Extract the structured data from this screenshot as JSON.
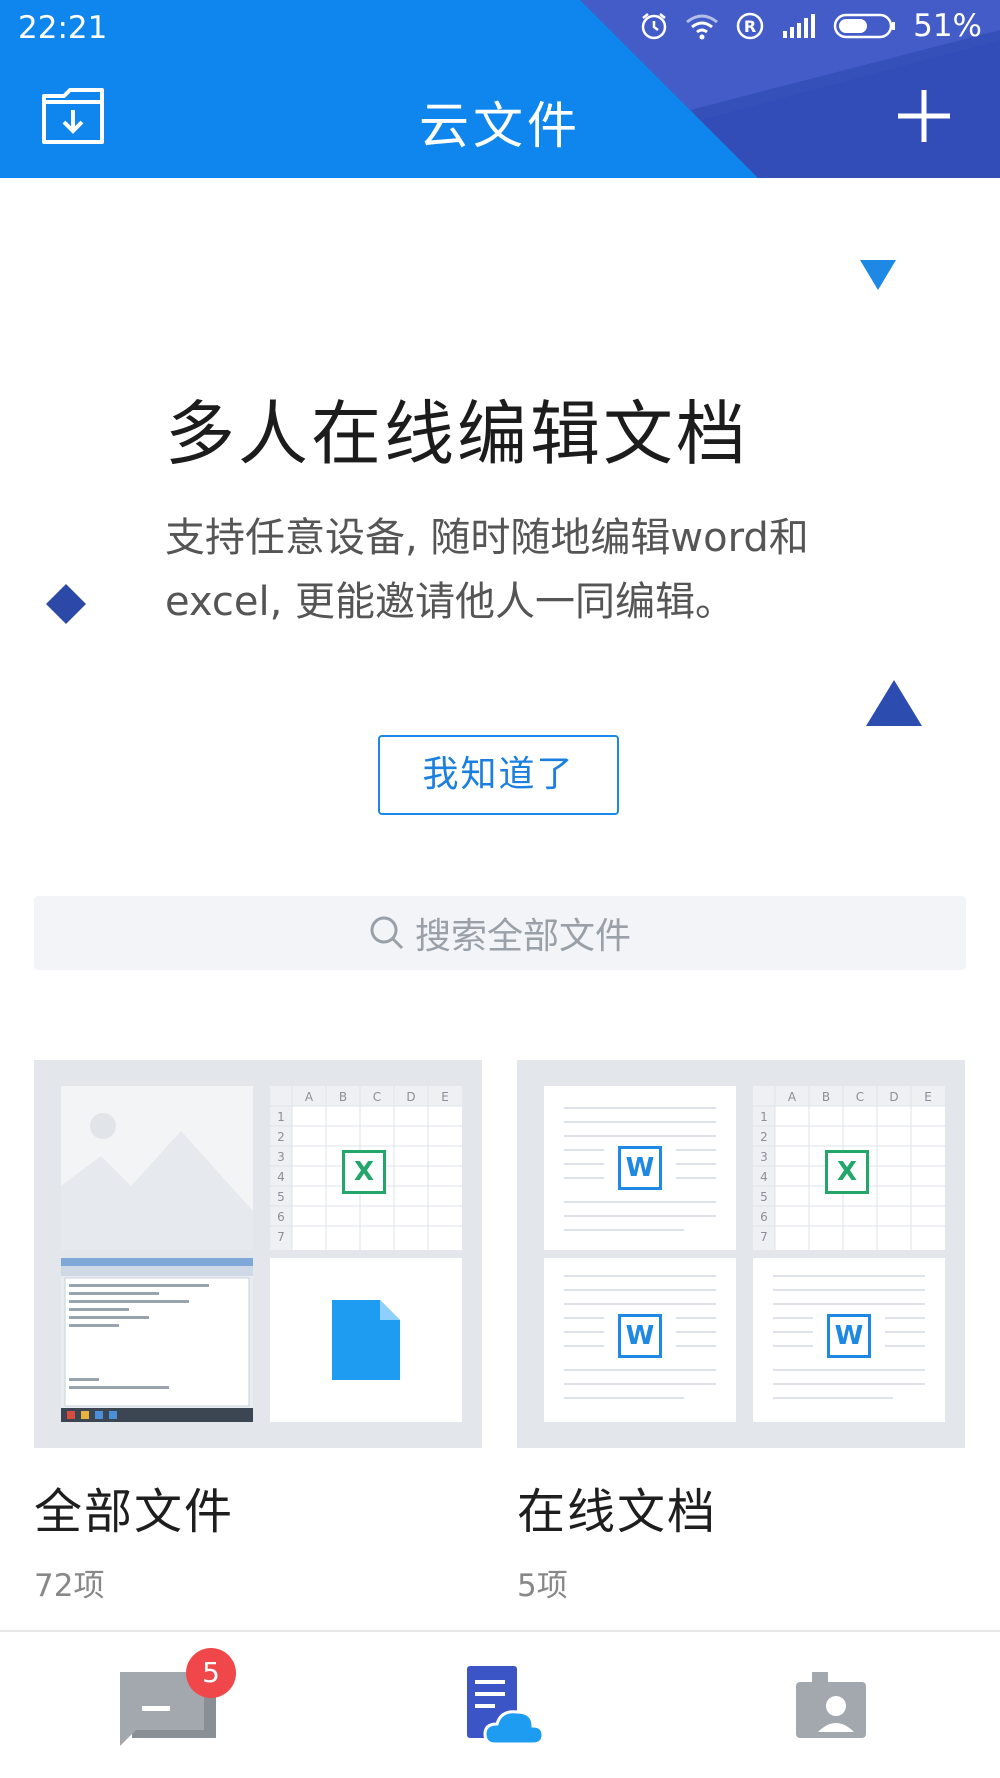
{
  "status_bar": {
    "time": "22:21",
    "battery": "51%",
    "icons": [
      "alarm-icon",
      "wifi-icon",
      "registered-icon",
      "signal-icon",
      "battery-icon"
    ]
  },
  "header": {
    "title": "云文件",
    "left_icon": "folder-download-icon",
    "right_icon": "plus-icon"
  },
  "promo": {
    "title": "多人在线编辑文档",
    "description": "支持任意设备, 随时随地编辑word和excel, 更能邀请他人一同编辑。",
    "button": "我知道了"
  },
  "search": {
    "placeholder": "搜索全部文件"
  },
  "folders": [
    {
      "name": "全部文件",
      "count": "72项"
    },
    {
      "name": "在线文档",
      "count": "5项"
    }
  ],
  "spreadsheet_preview": {
    "columns": [
      "A",
      "B",
      "C",
      "D",
      "E"
    ],
    "rows": [
      "1",
      "2",
      "3",
      "4",
      "5",
      "6",
      "7"
    ]
  },
  "file_badges": {
    "excel": "X",
    "word": "W"
  },
  "bottom_nav": {
    "items": [
      {
        "icon": "messages-icon",
        "badge": "5"
      },
      {
        "icon": "cloud-docs-icon"
      },
      {
        "icon": "contacts-icon"
      }
    ]
  },
  "colors": {
    "header_blue": "#0f86ee",
    "header_dark": "#3a4fb5",
    "accent": "#1b88e8",
    "excel_green": "#22a66a",
    "badge_red": "#f0474a"
  }
}
